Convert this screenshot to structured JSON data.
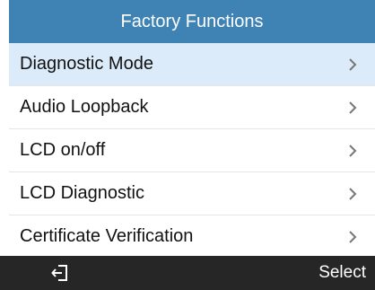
{
  "header": {
    "title": "Factory Functions",
    "color": "#3f83b4"
  },
  "menu": {
    "selected_index": 0,
    "items": [
      {
        "label": "Diagnostic Mode"
      },
      {
        "label": "Audio Loopback"
      },
      {
        "label": "LCD on/off"
      },
      {
        "label": "LCD Diagnostic"
      },
      {
        "label": "Certificate Verification"
      }
    ]
  },
  "softkeys": {
    "back_icon": "exit-icon",
    "select_label": "Select"
  }
}
